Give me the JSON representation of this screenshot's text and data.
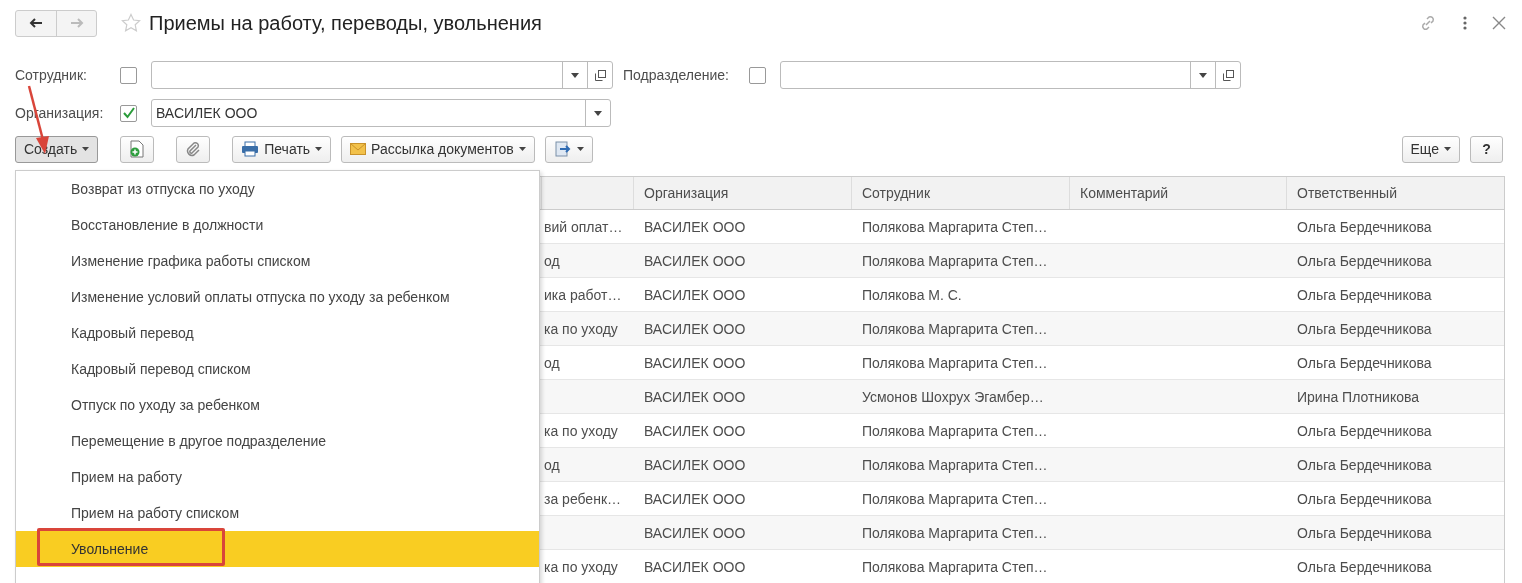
{
  "window": {
    "title": "Приемы на работу, переводы, увольнения"
  },
  "filters": [
    {
      "label": "Сотрудник:",
      "checked": false,
      "open_button": true
    },
    {
      "label": "Подразделение:",
      "checked": false,
      "open_button": true
    },
    {
      "label": "Организация:",
      "checked": true,
      "value": "ВАСИЛЕК ООО",
      "open_button": false
    }
  ],
  "toolbar": [
    {
      "kind": "text",
      "label": "Создать",
      "dropdown": true,
      "expanded": true
    },
    {
      "kind": "new-doc",
      "dropdown": false,
      "expanded": false
    },
    {
      "kind": "attach",
      "dropdown": false,
      "expanded": false
    },
    {
      "kind": "print",
      "label": "Печать",
      "dropdown": true,
      "expanded": false
    },
    {
      "kind": "mail",
      "label": "Рассылка документов",
      "dropdown": true,
      "expanded": false
    },
    {
      "kind": "export",
      "dropdown": true,
      "expanded": false
    }
  ],
  "toolbar_right": [
    {
      "label": "Еще",
      "dropdown": true
    },
    {
      "label": "?",
      "dropdown": false
    }
  ],
  "create_menu": [
    {
      "label": "Возврат из отпуска по уходу",
      "selected": false
    },
    {
      "label": "Восстановление в должности",
      "selected": false
    },
    {
      "label": "Изменение графика работы списком",
      "selected": false
    },
    {
      "label": "Изменение условий оплаты отпуска по уходу за ребенком",
      "selected": false
    },
    {
      "label": "Кадровый перевод",
      "selected": false
    },
    {
      "label": "Кадровый перевод списком",
      "selected": false
    },
    {
      "label": "Отпуск по уходу за ребенком",
      "selected": false
    },
    {
      "label": "Перемещение в другое подразделение",
      "selected": false
    },
    {
      "label": "Прием на работу",
      "selected": false
    },
    {
      "label": "Прием на работу списком",
      "selected": false
    },
    {
      "label": "Увольнение",
      "selected": true
    }
  ],
  "table": {
    "columns": [
      "Организация",
      "Сотрудник",
      "Комментарий",
      "Ответственный"
    ],
    "rows": [
      {
        "column_1": "вий оплат…",
        "organization": "ВАСИЛЕК ООО",
        "employee": "Полякова Маргарита Степ…",
        "responsible": "Ольга Бердечникова"
      },
      {
        "column_1": "од",
        "organization": "ВАСИЛЕК ООО",
        "employee": "Полякова Маргарита Степ…",
        "responsible": "Ольга Бердечникова"
      },
      {
        "column_1": "ика работ…",
        "organization": "ВАСИЛЕК ООО",
        "employee": "Полякова М. С.",
        "responsible": "Ольга Бердечникова"
      },
      {
        "column_1": "ка по уходу",
        "organization": "ВАСИЛЕК ООО",
        "employee": "Полякова Маргарита Степ…",
        "responsible": "Ольга Бердечникова"
      },
      {
        "column_1": "од",
        "organization": "ВАСИЛЕК ООО",
        "employee": "Полякова Маргарита Степ…",
        "responsible": "Ольга Бердечникова"
      },
      {
        "organization": "ВАСИЛЕК ООО",
        "employee": "Усмонов Шохрух Эгамбер…",
        "responsible": "Ирина Плотникова"
      },
      {
        "column_1": "ка по уходу",
        "organization": "ВАСИЛЕК ООО",
        "employee": "Полякова Маргарита Степ…",
        "responsible": "Ольга Бердечникова"
      },
      {
        "column_1": "од",
        "organization": "ВАСИЛЕК ООО",
        "employee": "Полякова Маргарита Степ…",
        "responsible": "Ольга Бердечникова"
      },
      {
        "column_1": "за ребенк…",
        "organization": "ВАСИЛЕК ООО",
        "employee": "Полякова Маргарита Степ…",
        "responsible": "Ольга Бердечникова"
      },
      {
        "organization": "ВАСИЛЕК ООО",
        "employee": "Полякова Маргарита Степ…",
        "responsible": "Ольга Бердечникова"
      },
      {
        "column_1": "ка по уходу",
        "organization": "ВАСИЛЕК ООО",
        "employee": "Полякова Маргарита Степ…",
        "responsible": "Ольга Бердечникова"
      }
    ]
  }
}
